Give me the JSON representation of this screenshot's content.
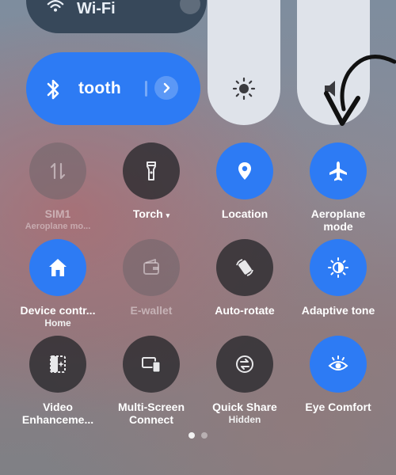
{
  "wifi": {
    "label": "Wi-Fi",
    "icon": "wifi-icon",
    "arrow_icon": "chevron-right-icon"
  },
  "bluetooth": {
    "label": "tooth",
    "icon": "bluetooth-icon",
    "arrow_icon": "chevron-right-icon",
    "active": true
  },
  "sliders": [
    {
      "icon": "brightness-icon"
    },
    {
      "icon": "volume-icon"
    }
  ],
  "tiles": [
    {
      "label": "SIM1",
      "sub": "Aeroplane mo...",
      "icon": "mobile-data-icon",
      "state": "disabled"
    },
    {
      "label": "Torch",
      "sub": "",
      "icon": "flashlight-icon",
      "state": "off"
    },
    {
      "label": "Location",
      "sub": "",
      "icon": "location-pin-icon",
      "state": "on"
    },
    {
      "label": "Aeroplane mode",
      "sub": "",
      "icon": "airplane-icon",
      "state": "on"
    },
    {
      "label": "Device contr...",
      "sub": "Home",
      "icon": "home-icon",
      "state": "on"
    },
    {
      "label": "E-wallet",
      "sub": "",
      "icon": "wallet-icon",
      "state": "disabled"
    },
    {
      "label": "Auto-rotate",
      "sub": "",
      "icon": "auto-rotate-icon",
      "state": "off"
    },
    {
      "label": "Adaptive tone",
      "sub": "",
      "icon": "adaptive-tone-icon",
      "state": "on"
    },
    {
      "label": "Video Enhanceme...",
      "sub": "",
      "icon": "video-enhance-icon",
      "state": "off"
    },
    {
      "label": "Multi-Screen Connect",
      "sub": "",
      "icon": "multi-screen-icon",
      "state": "off"
    },
    {
      "label": "Quick Share",
      "sub": "Hidden",
      "icon": "quick-share-icon",
      "state": "off"
    },
    {
      "label": "Eye Comfort",
      "sub": "",
      "icon": "eye-comfort-icon",
      "state": "on"
    }
  ],
  "pagination": {
    "pages": 2,
    "current": 1
  },
  "annotation": {
    "icon": "curved-arrow-icon",
    "color": "#111111"
  },
  "colors": {
    "accent": "#2d7bf4",
    "tile_off": "#28282c",
    "slider": "#dfe3ea",
    "wifi_pill": "#37485a"
  }
}
